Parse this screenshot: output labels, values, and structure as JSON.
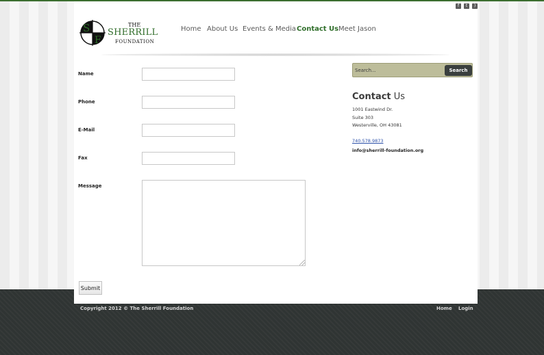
{
  "colors": {
    "brand_green": "#2e6b28",
    "footer_bg": "#2f3433",
    "search_bg": "#bdbd9a",
    "link_blue": "#2a4fa8"
  },
  "social": {
    "icons": [
      "facebook-icon",
      "twitter-icon",
      "rss-icon"
    ]
  },
  "logo": {
    "the": "THE",
    "name": "SHERRILL",
    "foundation": "FOUNDATION",
    "monogram_s": "S",
    "monogram_f": "F"
  },
  "nav": {
    "items": [
      {
        "label": "Home"
      },
      {
        "label": "About Us"
      },
      {
        "label": "Events & Media"
      },
      {
        "label": "Contact Us",
        "active": true
      },
      {
        "label": "Meet Jason"
      }
    ]
  },
  "form": {
    "name_label": "Name",
    "phone_label": "Phone",
    "email_label": "E-Mail",
    "fax_label": "Fax",
    "message_label": "Message",
    "name_value": "",
    "phone_value": "",
    "email_value": "",
    "fax_value": "",
    "message_value": "",
    "submit_label": "Submit"
  },
  "sidebar": {
    "search_placeholder": "Search...",
    "search_button": "Search",
    "contact_title_bold": "Contact",
    "contact_title_rest": " Us",
    "address_line1": "1001 Eastwind Dr.",
    "address_line2": "Suite 303",
    "address_line3": "Westerville, OH 43081",
    "phone": "740.578.9873",
    "email": "info@sherrill-foundation.org"
  },
  "footer": {
    "copyright": "Copyright 2012 © The Sherrill Foundation",
    "home_link": "Home",
    "login_link": "Login"
  }
}
